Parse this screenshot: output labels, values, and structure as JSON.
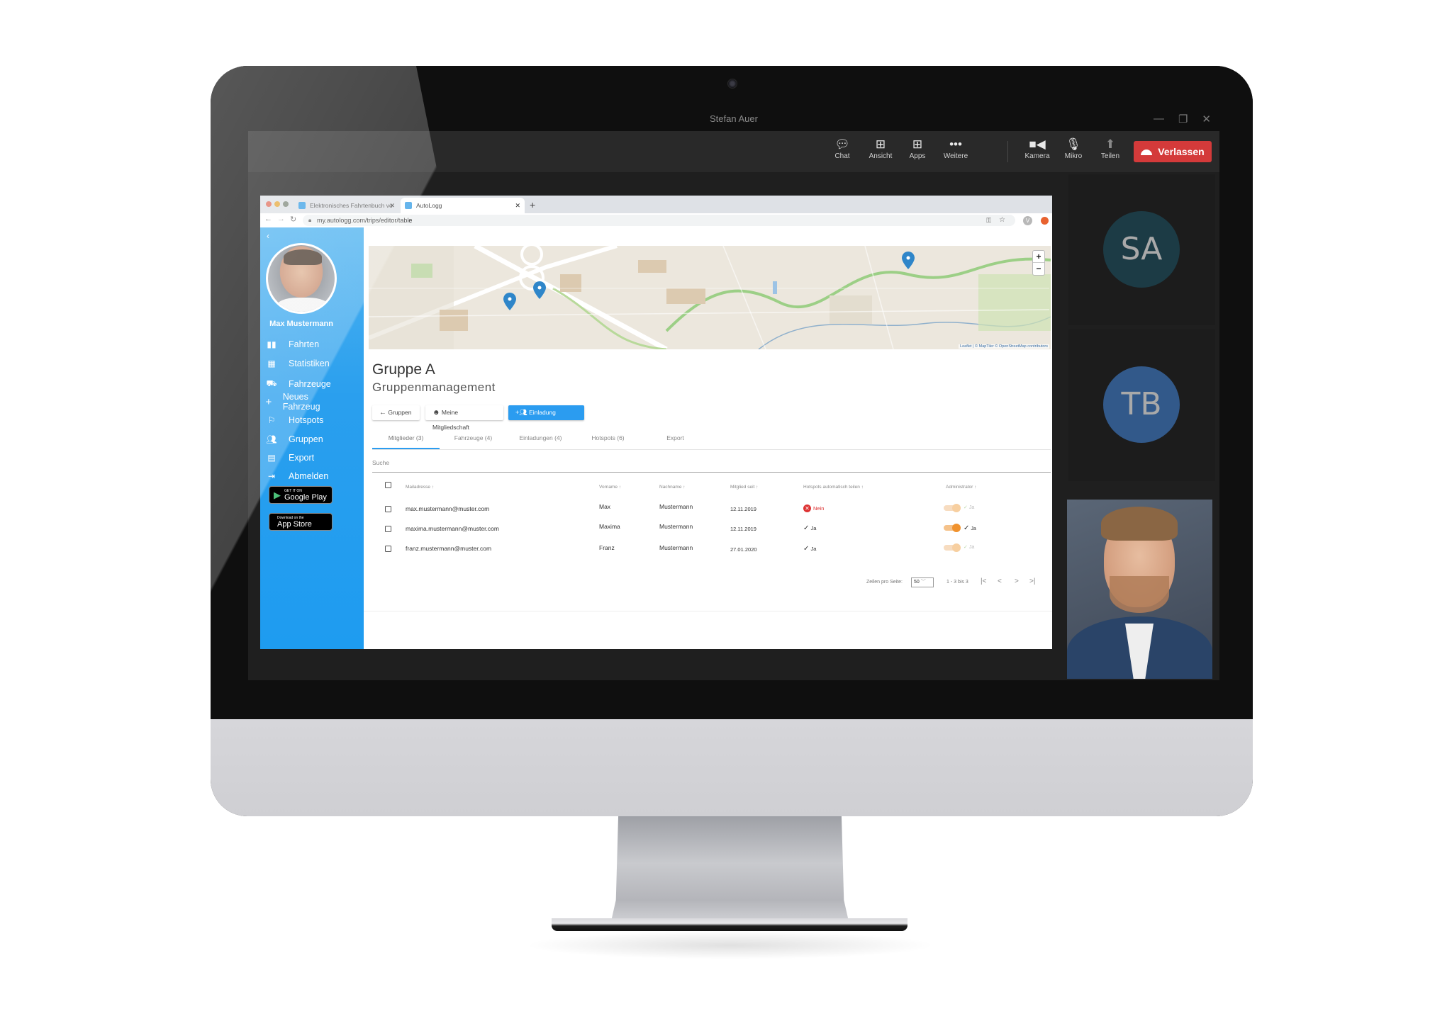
{
  "teams": {
    "window_title": "Stefan Auer",
    "window_controls": {
      "minimize": "—",
      "restore": "❐",
      "close": "✕"
    },
    "toolbar": [
      {
        "label": "Chat",
        "icon": "chat-icon"
      },
      {
        "label": "Ansicht",
        "icon": "grid-icon"
      },
      {
        "label": "Apps",
        "icon": "apps-plus-icon"
      },
      {
        "label": "Weitere",
        "icon": "more-dots-icon"
      },
      {
        "label": "Kamera",
        "icon": "camera-icon"
      },
      {
        "label": "Mikro",
        "icon": "microphone-icon"
      },
      {
        "label": "Teilen",
        "icon": "share-icon"
      }
    ],
    "leave_label": "Verlassen",
    "participants": [
      {
        "initials": "SA",
        "color": "#1c3b45"
      },
      {
        "initials": "TB",
        "color": "#32598a"
      }
    ]
  },
  "browser": {
    "tabs": [
      {
        "title": "Elektronisches Fahrtenbuch vo",
        "active": false
      },
      {
        "title": "AutoLogg",
        "active": true
      }
    ],
    "new_tab": "+",
    "url": "my.autologg.com/trips/editor/table",
    "profile_initial": "V"
  },
  "sidebar": {
    "back": "‹",
    "user_name": "Max Mustermann",
    "items": [
      {
        "label": "Fahrten",
        "icon": "book-icon"
      },
      {
        "label": "Statistiken",
        "icon": "chart-icon"
      },
      {
        "label": "Fahrzeuge",
        "icon": "car-icon"
      },
      {
        "label": "Neues Fahrzeug",
        "icon": "plus-icon"
      },
      {
        "label": "Hotspots",
        "icon": "flag-icon"
      },
      {
        "label": "Gruppen",
        "icon": "group-icon"
      },
      {
        "label": "Export",
        "icon": "document-icon"
      },
      {
        "label": "Abmelden",
        "icon": "logout-icon"
      }
    ],
    "store_badges": [
      {
        "small": "GET IT ON",
        "big": "Google Play"
      },
      {
        "small": "Download on the",
        "big": "App Store"
      }
    ]
  },
  "map": {
    "zoom_in": "+",
    "zoom_out": "−",
    "attribution": "Leaflet | © MapTiler © OpenStreetMap contributors"
  },
  "page": {
    "title": "Gruppe A",
    "subtitle": "Gruppenmanagement",
    "buttons": {
      "back": "Gruppen",
      "membership": "Meine Mitgliedschaft",
      "invite": "Einladung erstellen"
    },
    "tabs": [
      "Mitglieder (3)",
      "Fahrzeuge (4)",
      "Einladungen (4)",
      "Hotspots (6)",
      "Export"
    ],
    "active_tab": 0,
    "search_label": "Suche"
  },
  "table": {
    "headers": {
      "email": "Mailadresse ↑",
      "first": "Vorname ↑",
      "last": "Nachname ↑",
      "since": "Mitglied seit ↑",
      "hotspots": "Hotspots automatisch teilen ↑",
      "admin": "Administrator ↑"
    },
    "rows": [
      {
        "email": "max.mustermann@muster.com",
        "first": "Max",
        "last": "Mustermann",
        "since": "12.11.2019",
        "hotspots": "Nein",
        "hotspots_share": false,
        "admin": "Ja",
        "admin_on": true,
        "admin_disabled": true
      },
      {
        "email": "maxima.mustermann@muster.com",
        "first": "Maxima",
        "last": "Mustermann",
        "since": "12.11.2019",
        "hotspots": "Ja",
        "hotspots_share": true,
        "admin": "Ja",
        "admin_on": true,
        "admin_disabled": false
      },
      {
        "email": "franz.mustermann@muster.com",
        "first": "Franz",
        "last": "Mustermann",
        "since": "27.01.2020",
        "hotspots": "Ja",
        "hotspots_share": true,
        "admin": "Ja",
        "admin_on": true,
        "admin_disabled": true
      }
    ]
  },
  "pagination": {
    "rows_label": "Zeilen pro Seite:",
    "rows_value": "50",
    "range": "1 - 3 bis 3",
    "first": "|<",
    "prev": "<",
    "next": ">",
    "last": ">|"
  },
  "colors": {
    "accent": "#2b9cf0",
    "leave": "#d43a3a",
    "toggle_on": "#f0922e",
    "toggle_disabled": "#f7cfa0",
    "error": "#dd3333"
  }
}
